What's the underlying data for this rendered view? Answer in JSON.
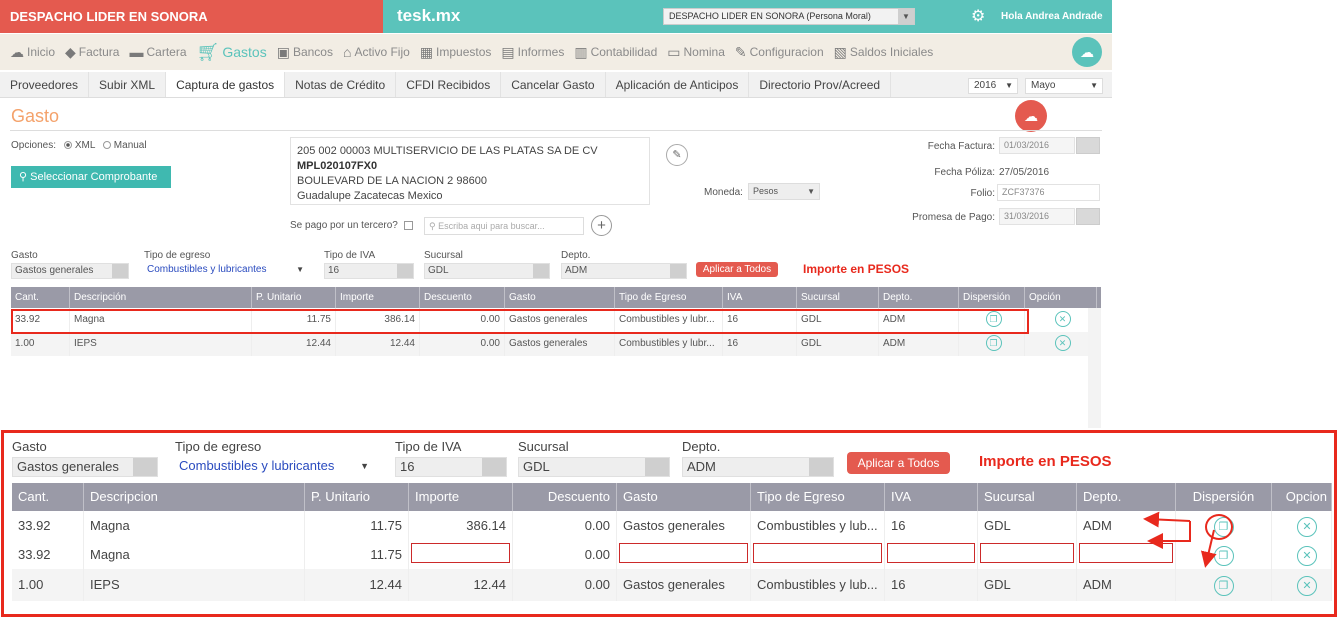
{
  "topbar": {
    "company": "DESPACHO LIDER EN SONORA",
    "logo": "tesk.mx",
    "company_select": "DESPACHO LIDER EN SONORA (Persona Moral)",
    "greeting": "Hola Andrea Andrade"
  },
  "main_menu": [
    {
      "label": "Inicio",
      "icon": "cloud-icon"
    },
    {
      "label": "Factura",
      "icon": "tag-icon"
    },
    {
      "label": "Cartera",
      "icon": "briefcase-icon"
    },
    {
      "label": "Gastos",
      "icon": "cart-icon"
    },
    {
      "label": "Bancos",
      "icon": "bank-icon"
    },
    {
      "label": "Activo Fijo",
      "icon": "house-icon"
    },
    {
      "label": "Impuestos",
      "icon": "calculator-icon"
    },
    {
      "label": "Informes",
      "icon": "document-icon"
    },
    {
      "label": "Contabilidad",
      "icon": "ledger-icon"
    },
    {
      "label": "Nomina",
      "icon": "card-icon"
    },
    {
      "label": "Configuracion",
      "icon": "wrench-icon"
    },
    {
      "label": "Saldos Iniciales",
      "icon": "balance-icon"
    }
  ],
  "sub_menu": [
    "Proveedores",
    "Subir XML",
    "Captura de gastos",
    "Notas de Crédito",
    "CFDI Recibidos",
    "Cancelar Gasto",
    "Aplicación de Anticipos",
    "Directorio Prov/Acreed"
  ],
  "period": {
    "year": "2016",
    "month": "Mayo"
  },
  "page_title": "Gasto",
  "options": {
    "label": "Opciones:",
    "xml": "XML",
    "manual": "Manual"
  },
  "select_button": "Seleccionar Comprobante",
  "supplier": {
    "line1": "205 002 00003 MULTISERVICIO DE LAS PLATAS SA DE CV",
    "rfc": "MPL020107FX0",
    "line3": "BOULEVARD DE LA NACION 2 98600",
    "line4": "Guadalupe Zacatecas Mexico"
  },
  "third_party": {
    "label": "Se pago por un tercero?",
    "placeholder": "Escriba aqui para buscar..."
  },
  "moneda": {
    "label": "Moneda:",
    "value": "Pesos"
  },
  "fecha_factura": {
    "label": "Fecha Factura:",
    "value": "01/03/2016"
  },
  "fecha_poliza": {
    "label": "Fecha Póliza:",
    "value": "27/05/2016"
  },
  "folio": {
    "label": "Folio:",
    "value": "ZCF37376"
  },
  "promesa": {
    "label": "Promesa de Pago:",
    "value": "31/03/2016"
  },
  "filters": {
    "gasto_label": "Gasto",
    "gasto_value": "Gastos generales",
    "tipo_egreso_label": "Tipo de egreso",
    "tipo_egreso_value": "Combustibles y lubricantes",
    "iva_label": "Tipo de IVA",
    "iva_value": "16",
    "sucursal_label": "Sucursal",
    "sucursal_value": "GDL",
    "depto_label": "Depto.",
    "depto_value": "ADM",
    "apply_button": "Aplicar a Todos",
    "importe_note": "Importe en PESOS"
  },
  "columns": [
    "Cant.",
    "Descripción",
    "P. Unitario",
    "Importe",
    "Descuento",
    "Gasto",
    "Tipo de Egreso",
    "IVA",
    "Sucursal",
    "Depto.",
    "Dispersión",
    "Opción"
  ],
  "small_rows": [
    {
      "cant": "33.92",
      "desc": "Magna",
      "pu": "11.75",
      "importe": "386.14",
      "descuento": "0.00",
      "gasto": "Gastos generales",
      "tipo": "Combustibles y lubr...",
      "iva": "16",
      "sucursal": "GDL",
      "depto": "ADM"
    },
    {
      "cant": "1.00",
      "desc": "IEPS",
      "pu": "12.44",
      "importe": "12.44",
      "descuento": "0.00",
      "gasto": "Gastos generales",
      "tipo": "Combustibles y lubr...",
      "iva": "16",
      "sucursal": "GDL",
      "depto": "ADM"
    }
  ],
  "zoom_columns": [
    "Cant.",
    "Descripcion",
    "P. Unitario",
    "Importe",
    "Descuento",
    "Gasto",
    "Tipo de Egreso",
    "IVA",
    "Sucursal",
    "Depto.",
    "Dispersión",
    "Opcion"
  ],
  "zoom_rows": [
    {
      "cant": "33.92",
      "desc": "Magna",
      "pu": "11.75",
      "importe": "386.14",
      "descuento": "0.00",
      "gasto": "Gastos generales",
      "tipo": "Combustibles y lub...",
      "iva": "16",
      "sucursal": "GDL",
      "depto": "ADM"
    },
    {
      "cant": "33.92",
      "desc": "Magna",
      "pu": "11.75",
      "importe": "",
      "descuento": "0.00",
      "gasto": "",
      "tipo": "",
      "iva": "",
      "sucursal": "",
      "depto": ""
    },
    {
      "cant": "1.00",
      "desc": "IEPS",
      "pu": "12.44",
      "importe": "12.44",
      "descuento": "0.00",
      "gasto": "Gastos generales",
      "tipo": "Combustibles y lub...",
      "iva": "16",
      "sucursal": "GDL",
      "depto": "ADM"
    }
  ],
  "colors": {
    "brand_red": "#e45a4f",
    "brand_teal": "#5bc3bb",
    "highlight": "#e8291d",
    "accent_orange": "#f4a26b"
  }
}
